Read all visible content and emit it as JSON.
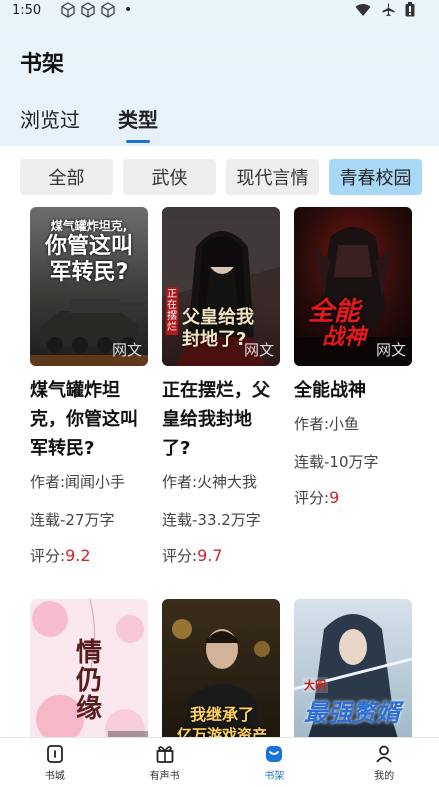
{
  "status": {
    "time": "1:50",
    "dot": "•"
  },
  "header": {
    "title": "书架"
  },
  "tabs": [
    {
      "label": "浏览过"
    },
    {
      "label": "类型"
    }
  ],
  "chips": [
    {
      "label": "全部"
    },
    {
      "label": "武侠"
    },
    {
      "label": "现代言情"
    },
    {
      "label": "青春校园"
    }
  ],
  "books": [
    {
      "title": "煤气罐炸坦克，你管这叫军转民?",
      "author": "作者:闻闻小手",
      "serial": "连载-27万字",
      "score_label": "评分:",
      "score": "9.2",
      "watermark": "网文",
      "cover_text": [
        "煤气罐炸坦克,",
        "你管这叫",
        "军转民?"
      ]
    },
    {
      "title": "正在摆烂，父皇给我封地了?",
      "author": "作者:火神大我",
      "serial": "连载-33.2万字",
      "score_label": "评分:",
      "score": "9.7",
      "watermark": "网文",
      "cover_text": [
        "正在摆烂",
        "父皇给我",
        "封地了?"
      ]
    },
    {
      "title": "全能战神",
      "author": "作者:小鱼",
      "serial": "连载-10万字",
      "score_label": "评分:",
      "score": "9",
      "watermark": "网文",
      "cover_text": [
        "全能",
        "战神"
      ]
    },
    {
      "cover_text": [
        "情",
        "仍",
        "缘"
      ]
    },
    {
      "cover_text": [
        "我继承了",
        "亿万游戏资产"
      ]
    },
    {
      "cover_text": [
        "大明",
        "最强赘婿"
      ]
    }
  ],
  "nav": [
    {
      "label": "书城"
    },
    {
      "label": "有声书"
    },
    {
      "label": "书架"
    },
    {
      "label": "我的"
    }
  ],
  "colors": {
    "accent": "#1a73d9",
    "score": "#d0212d",
    "chip_active": "#a8d8f5"
  }
}
